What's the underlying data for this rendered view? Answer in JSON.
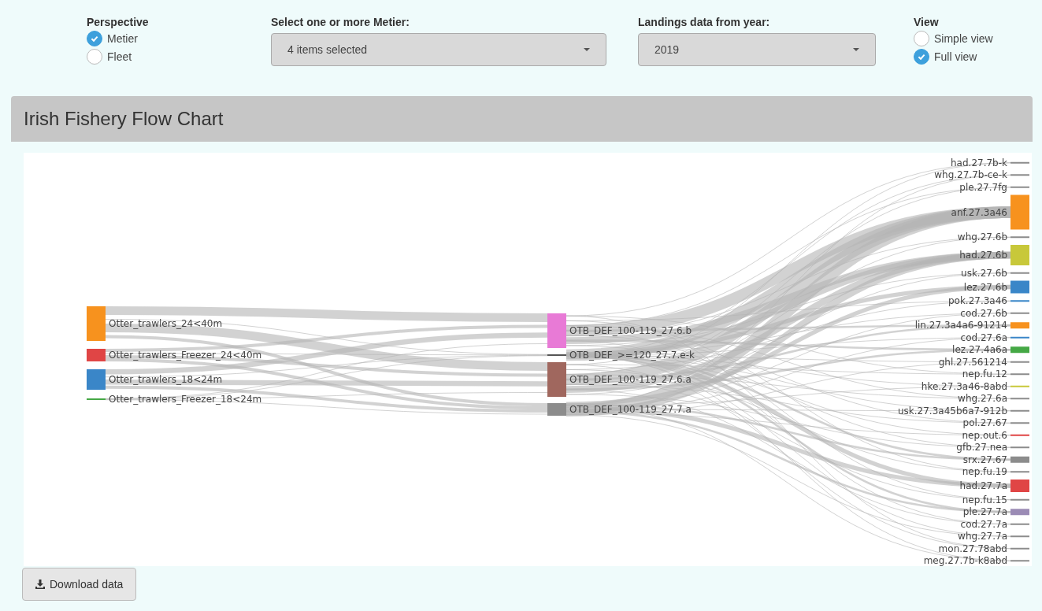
{
  "controls": {
    "perspective": {
      "label": "Perspective",
      "options": [
        {
          "label": "Metier",
          "selected": true
        },
        {
          "label": "Fleet",
          "selected": false
        }
      ]
    },
    "metier_select": {
      "label": "Select one or more Metier:",
      "value": "4 items selected"
    },
    "year_select": {
      "label": "Landings data from year:",
      "value": "2019"
    },
    "view": {
      "label": "View",
      "options": [
        {
          "label": "Simple view",
          "selected": false
        },
        {
          "label": "Full view",
          "selected": true
        }
      ]
    }
  },
  "panel": {
    "title": "Irish Fishery Flow Chart"
  },
  "flow_chart": {
    "fleets": [
      {
        "label": "Otter_trawlers_24<40m",
        "kind": "large",
        "color": "#f7921e"
      },
      {
        "label": "Otter_trawlers_Freezer_24<40m",
        "kind": "small",
        "color": "#e04545"
      },
      {
        "label": "Otter_trawlers_18<24m",
        "kind": "medium",
        "color": "#3a86c8"
      },
      {
        "label": "Otter_trawlers_Freezer_18<24m",
        "kind": "line",
        "color": "#45a845"
      }
    ],
    "metiers": [
      {
        "label": "OTB_DEF_100-119_27.6.b",
        "kind": "large",
        "color": "#e87ad6"
      },
      {
        "label": "OTB_DEF_>=120_27.7.e-k",
        "kind": "line",
        "color": "#555555"
      },
      {
        "label": "OTB_DEF_100-119_27.6.a",
        "kind": "large",
        "color": "#a0675e"
      },
      {
        "label": "OTB_DEF_100-119_27.7.a",
        "kind": "small",
        "color": "#8c8c8c"
      }
    ],
    "species": [
      {
        "label": "had.27.7b-k",
        "kind": "line",
        "color": "#8c8c8c"
      },
      {
        "label": "whg.27.7b-ce-k",
        "kind": "line",
        "color": "#8c8c8c"
      },
      {
        "label": "ple.27.7fg",
        "kind": "line",
        "color": "#8c8c8c"
      },
      {
        "label": "anf.27.3a46",
        "kind": "large",
        "color": "#f7921e"
      },
      {
        "label": "whg.27.6b",
        "kind": "line",
        "color": "#8c8c8c"
      },
      {
        "label": "had.27.6b",
        "kind": "medium",
        "color": "#c8c83a"
      },
      {
        "label": "usk.27.6b",
        "kind": "line",
        "color": "#8c8c8c"
      },
      {
        "label": "lez.27.6b",
        "kind": "small",
        "color": "#3a86c8"
      },
      {
        "label": "pok.27.3a46",
        "kind": "line",
        "color": "#3a86c8"
      },
      {
        "label": "cod.27.6b",
        "kind": "line",
        "color": "#8c8c8c"
      },
      {
        "label": "lin.27.3a4a6-91214",
        "kind": "thin",
        "color": "#f7921e"
      },
      {
        "label": "cod.27.6a",
        "kind": "line",
        "color": "#3a86c8"
      },
      {
        "label": "lez.27.4a6a",
        "kind": "thin",
        "color": "#45a845"
      },
      {
        "label": "ghl.27.561214",
        "kind": "line",
        "color": "#8c8c8c"
      },
      {
        "label": "nep.fu.12",
        "kind": "line",
        "color": "#8c8c8c"
      },
      {
        "label": "hke.27.3a46-8abd",
        "kind": "line",
        "color": "#c8c83a"
      },
      {
        "label": "whg.27.6a",
        "kind": "line",
        "color": "#8c8c8c"
      },
      {
        "label": "usk.27.3a45b6a7-912b",
        "kind": "line",
        "color": "#8c8c8c"
      },
      {
        "label": "pol.27.67",
        "kind": "line",
        "color": "#8c8c8c"
      },
      {
        "label": "nep.out.6",
        "kind": "line",
        "color": "#e04545"
      },
      {
        "label": "gfb.27.nea",
        "kind": "line",
        "color": "#8c8c8c"
      },
      {
        "label": "srx.27.67",
        "kind": "thin",
        "color": "#8c8c8c"
      },
      {
        "label": "nep.fu.19",
        "kind": "line",
        "color": "#8c8c8c"
      },
      {
        "label": "had.27.7a",
        "kind": "small",
        "color": "#e04545"
      },
      {
        "label": "nep.fu.15",
        "kind": "line",
        "color": "#8c8c8c"
      },
      {
        "label": "ple.27.7a",
        "kind": "thin",
        "color": "#9b8bb5"
      },
      {
        "label": "cod.27.7a",
        "kind": "line",
        "color": "#8c8c8c"
      },
      {
        "label": "whg.27.7a",
        "kind": "line",
        "color": "#8c8c8c"
      },
      {
        "label": "mon.27.78abd",
        "kind": "line",
        "color": "#8c8c8c"
      },
      {
        "label": "meg.27.7b-k8abd",
        "kind": "line",
        "color": "#8c8c8c"
      }
    ]
  },
  "download_button": {
    "label": "Download data"
  }
}
